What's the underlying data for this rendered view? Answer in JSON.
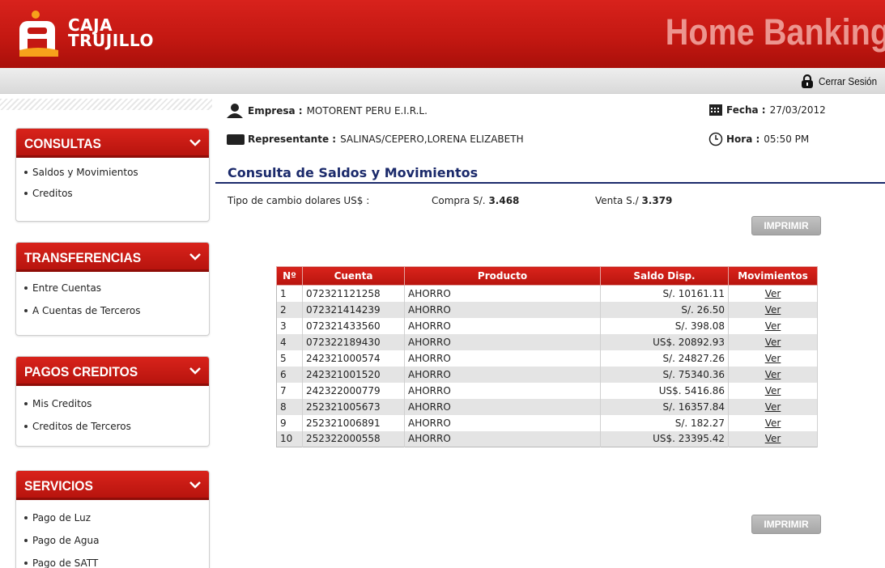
{
  "header": {
    "brand_line1": "CAJA",
    "brand_line2": "TRUJILLO",
    "title": "Home Banking",
    "logout_label": "Cerrar Sesión",
    "logout_icon": "lock-icon"
  },
  "sidebar": {
    "menus": [
      {
        "title": "CONSULTAS",
        "items": [
          "Saldos y Movimientos",
          "Creditos"
        ]
      },
      {
        "title": "TRANSFERENCIAS",
        "items": [
          "Entre Cuentas",
          "A Cuentas de Terceros"
        ]
      },
      {
        "title": "PAGOS CREDITOS",
        "items": [
          "Mis Creditos",
          "Creditos de Terceros"
        ]
      },
      {
        "title": "SERVICIOS",
        "items": [
          "Pago de Luz",
          "Pago de Agua",
          "Pago de SATT"
        ]
      }
    ]
  },
  "info": {
    "empresa_label": "Empresa :",
    "empresa_value": "MOTORENT PERU E.I.R.L.",
    "representante_label": "Representante :",
    "representante_value": "SALINAS/CEPERO,LORENA ELIZABETH",
    "fecha_label": "Fecha :",
    "fecha_value": "27/03/2012",
    "hora_label": "Hora :",
    "hora_value": "05:50 PM"
  },
  "section": {
    "title": "Consulta de Saldos y Movimientos",
    "tipo_cambio_label": "Tipo de cambio dolares US$ :",
    "compra_label": "Compra S/.",
    "compra_value": "3.468",
    "venta_label": "Venta S./",
    "venta_value": "3.379",
    "print_label": "IMPRIMIR"
  },
  "table": {
    "headers": [
      "Nº",
      "Cuenta",
      "Producto",
      "Saldo Disp.",
      "Movimientos"
    ],
    "link_label": "Ver",
    "rows": [
      {
        "n": "1",
        "cuenta": "072321121258",
        "producto": "AHORRO",
        "saldo": "S/. 10161.11"
      },
      {
        "n": "2",
        "cuenta": "072321414239",
        "producto": "AHORRO",
        "saldo": "S/. 26.50"
      },
      {
        "n": "3",
        "cuenta": "072321433560",
        "producto": "AHORRO",
        "saldo": "S/. 398.08"
      },
      {
        "n": "4",
        "cuenta": "072322189430",
        "producto": "AHORRO",
        "saldo": "US$. 20892.93"
      },
      {
        "n": "5",
        "cuenta": "242321000574",
        "producto": "AHORRO",
        "saldo": "S/. 24827.26"
      },
      {
        "n": "6",
        "cuenta": "242321001520",
        "producto": "AHORRO",
        "saldo": "S/. 75340.36"
      },
      {
        "n": "7",
        "cuenta": "242322000779",
        "producto": "AHORRO",
        "saldo": "US$. 5416.86"
      },
      {
        "n": "8",
        "cuenta": "252321005673",
        "producto": "AHORRO",
        "saldo": "S/. 16357.84"
      },
      {
        "n": "9",
        "cuenta": "252321006891",
        "producto": "AHORRO",
        "saldo": "S/. 182.27"
      },
      {
        "n": "10",
        "cuenta": "252322000558",
        "producto": "AHORRO",
        "saldo": "US$. 23395.42"
      }
    ]
  },
  "colors": {
    "brand_red": "#c41812",
    "nav_blue": "#1b2a6b",
    "button_gray": "#a6a6a6"
  }
}
